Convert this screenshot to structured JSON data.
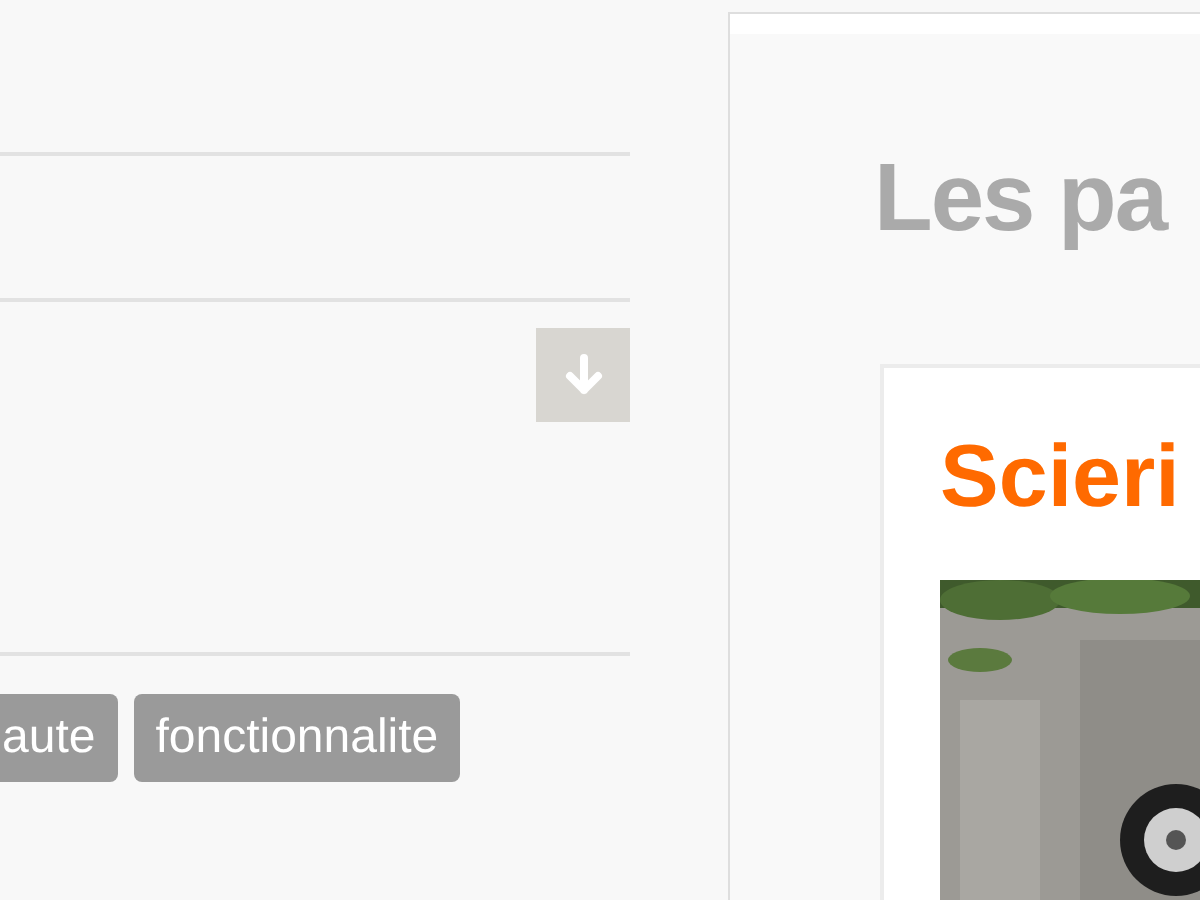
{
  "left_column": {
    "tags": [
      {
        "label": "aute"
      },
      {
        "label": "fonctionnalite"
      }
    ]
  },
  "right_panel": {
    "heading": "Les pa",
    "card": {
      "title": "Scieri"
    }
  }
}
